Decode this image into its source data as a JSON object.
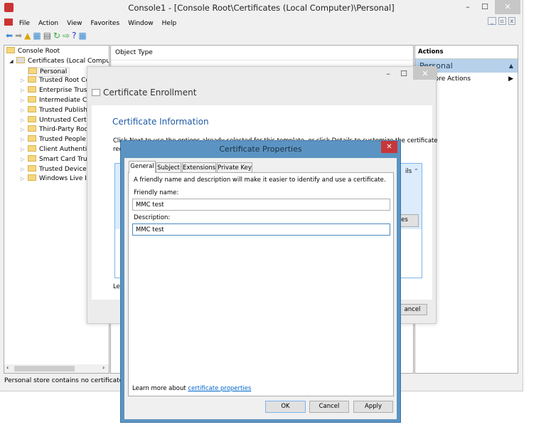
{
  "main": {
    "title": "Console1 - [Console Root\\Certificates (Local Computer)\\Personal]",
    "menu": [
      "File",
      "Action",
      "View",
      "Favorites",
      "Window",
      "Help"
    ],
    "tree": {
      "root": "Console Root",
      "certs": "Certificates (Local Compute",
      "items": [
        "Personal",
        "Trusted Root Cer",
        "Enterprise Trust",
        "Intermediate Cer",
        "Trusted Publishe",
        "Untrusted Certifi",
        "Third-Party Root",
        "Trusted People",
        "Client Authentic",
        "Smart Card Trust",
        "Trusted Devices",
        "Windows Live ID"
      ]
    },
    "center_header": "Object Type",
    "actions": {
      "header": "Actions",
      "section": "Personal",
      "more": "More Actions"
    },
    "status": "Personal store contains no certificates."
  },
  "enroll": {
    "title": "Certificate Enrollment",
    "heading": "Certificate Information",
    "text1": "Click Next to use the options already selected for this template, or click Details to customize the certificate",
    "text2": "req",
    "details": "ils",
    "props_btn": "es",
    "learn": "Lea",
    "cancel": "ancel"
  },
  "props": {
    "title": "Certificate Properties",
    "tabs": [
      "General",
      "Subject",
      "Extensions",
      "Private Key"
    ],
    "intro": "A friendly name and description will make it easier to identify and use a certificate.",
    "friendly_label": "Friendly name:",
    "friendly_value": "MMC test",
    "desc_label": "Description:",
    "desc_value": "MMC test",
    "learn_prefix": "Learn more about ",
    "learn_link": "certificate properties",
    "ok": "OK",
    "cancel": "Cancel",
    "apply": "Apply"
  },
  "colors": {
    "accent": "#4a8ac0",
    "close": "#c7373a",
    "link": "#0066cc"
  }
}
